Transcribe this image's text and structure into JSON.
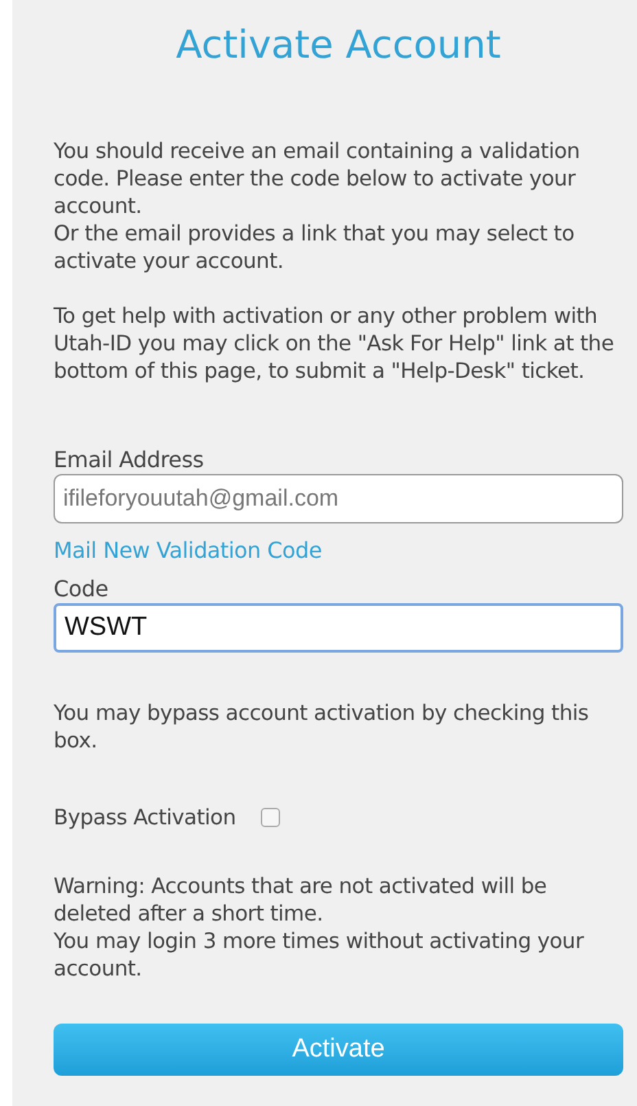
{
  "title": "Activate Account",
  "intro": [
    [
      "You should receive an email containing a validation code. Please enter the code below to activate your account.",
      "Or the email provides a link that you may select to activate your account."
    ],
    [
      "To get help with activation or any other problem with Utah-ID you may click on the \"Ask For Help\" link at the bottom of this page, to submit a \"Help-Desk\" ticket."
    ]
  ],
  "email": {
    "label": "Email Address",
    "value": "ifileforyouutah@gmail.com"
  },
  "mail_link": "Mail New Validation Code",
  "code": {
    "label": "Code",
    "value": "WSWT",
    "focused": true
  },
  "bypass_note": "You may bypass account activation by checking this box.",
  "bypass": {
    "label": "Bypass Activation",
    "checked": false
  },
  "warning": [
    "Warning: Accounts that are not activated will be deleted after a short time.",
    "You may login 3 more times without activating your account."
  ],
  "button": "Activate"
}
